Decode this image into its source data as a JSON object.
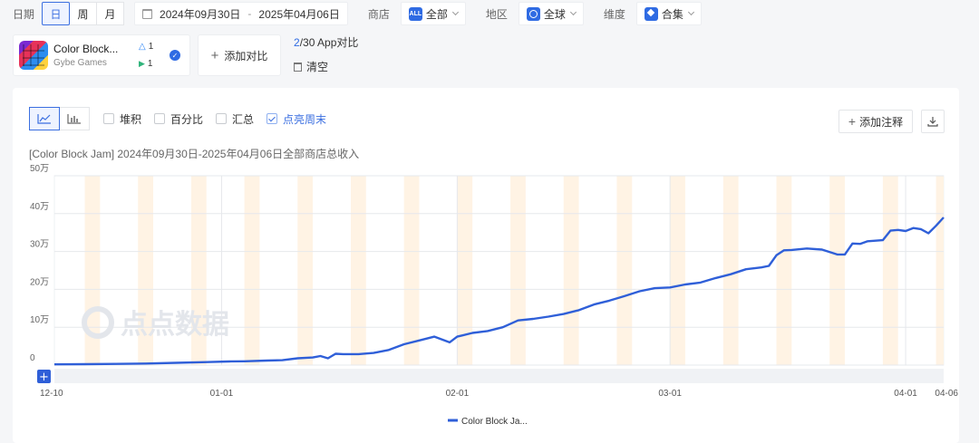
{
  "filters": {
    "date_label": "日期",
    "granularity": [
      {
        "label": "日",
        "active": true
      },
      {
        "label": "周",
        "active": false
      },
      {
        "label": "月",
        "active": false
      }
    ],
    "date_start": "2024年09月30日",
    "date_sep": "-",
    "date_end": "2025年04月06日",
    "store_label": "商店",
    "store_icon_text": "ALL",
    "store_value": "全部",
    "region_label": "地区",
    "region_value": "全球",
    "dimension_label": "维度",
    "dimension_value": "合集"
  },
  "app": {
    "name": "Color Block...",
    "developer": "Gybe Games",
    "ios_count": "1",
    "gp_count": "1"
  },
  "compare": {
    "add_label": "添加对比",
    "count_current": "2",
    "count_rest": "/30 App对比",
    "clear_label": "清空"
  },
  "options": {
    "stack": "堆积",
    "percent": "百分比",
    "summary": "汇总",
    "weekend": "点亮周末"
  },
  "actions": {
    "add_note": "添加注释"
  },
  "watermark": "点点数据",
  "colors": {
    "line": "#2f5fd8",
    "weekend_band": "#fff3e4",
    "accent": "#3b6fe0"
  },
  "chart_data": {
    "type": "line",
    "title": "[Color Block Jam] 2024年09月30日-2025年04月06日全部商店总收入",
    "y_unit": "万",
    "ylim": [
      0,
      500000
    ],
    "y_ticks": [
      {
        "value": 0,
        "label": "0"
      },
      {
        "value": 100000,
        "label": "10万"
      },
      {
        "value": 200000,
        "label": "20万"
      },
      {
        "value": 300000,
        "label": "30万"
      },
      {
        "value": 400000,
        "label": "40万"
      },
      {
        "value": 500000,
        "label": "50万"
      }
    ],
    "x_range": [
      "2024-12-10",
      "2025-04-06"
    ],
    "x_ticks": [
      {
        "date": "2024-12-10",
        "label": "12-10"
      },
      {
        "date": "2025-01-01",
        "label": "01-01"
      },
      {
        "date": "2025-02-01",
        "label": "02-01"
      },
      {
        "date": "2025-03-01",
        "label": "03-01"
      },
      {
        "date": "2025-04-01",
        "label": "04-01"
      },
      {
        "date": "2025-04-06",
        "label": "04-06"
      }
    ],
    "grid": true,
    "weekend_highlight": true,
    "legend_position": "bottom-center",
    "series": [
      {
        "name": "Color Block Ja...",
        "color": "#2f5fd8",
        "points": [
          [
            "2024-12-10",
            2000
          ],
          [
            "2024-12-14",
            2500
          ],
          [
            "2024-12-18",
            3000
          ],
          [
            "2024-12-22",
            4000
          ],
          [
            "2024-12-26",
            6000
          ],
          [
            "2024-12-30",
            8000
          ],
          [
            "2025-01-02",
            9500
          ],
          [
            "2025-01-04",
            10000
          ],
          [
            "2025-01-07",
            12000
          ],
          [
            "2025-01-09",
            13000
          ],
          [
            "2025-01-11",
            18000
          ],
          [
            "2025-01-13",
            20000
          ],
          [
            "2025-01-14",
            24000
          ],
          [
            "2025-01-15",
            18000
          ],
          [
            "2025-01-16",
            30000
          ],
          [
            "2025-01-17",
            29000
          ],
          [
            "2025-01-19",
            29000
          ],
          [
            "2025-01-21",
            32000
          ],
          [
            "2025-01-23",
            40000
          ],
          [
            "2025-01-25",
            55000
          ],
          [
            "2025-01-27",
            65000
          ],
          [
            "2025-01-29",
            75000
          ],
          [
            "2025-01-31",
            60000
          ],
          [
            "2025-02-01",
            75000
          ],
          [
            "2025-02-03",
            85000
          ],
          [
            "2025-02-05",
            90000
          ],
          [
            "2025-02-07",
            100000
          ],
          [
            "2025-02-09",
            118000
          ],
          [
            "2025-02-11",
            122000
          ],
          [
            "2025-02-13",
            128000
          ],
          [
            "2025-02-15",
            135000
          ],
          [
            "2025-02-17",
            145000
          ],
          [
            "2025-02-19",
            160000
          ],
          [
            "2025-02-21",
            170000
          ],
          [
            "2025-02-23",
            182000
          ],
          [
            "2025-02-25",
            195000
          ],
          [
            "2025-02-27",
            203000
          ],
          [
            "2025-03-01",
            205000
          ],
          [
            "2025-03-03",
            213000
          ],
          [
            "2025-03-05",
            218000
          ],
          [
            "2025-03-07",
            230000
          ],
          [
            "2025-03-09",
            240000
          ],
          [
            "2025-03-11",
            253000
          ],
          [
            "2025-03-13",
            258000
          ],
          [
            "2025-03-14",
            262000
          ],
          [
            "2025-03-15",
            290000
          ],
          [
            "2025-03-16",
            303000
          ],
          [
            "2025-03-17",
            304000
          ],
          [
            "2025-03-19",
            308000
          ],
          [
            "2025-03-21",
            305000
          ],
          [
            "2025-03-23",
            292000
          ],
          [
            "2025-03-24",
            292000
          ],
          [
            "2025-03-25",
            321000
          ],
          [
            "2025-03-26",
            320000
          ],
          [
            "2025-03-27",
            327000
          ],
          [
            "2025-03-29",
            330000
          ],
          [
            "2025-03-30",
            355000
          ],
          [
            "2025-03-31",
            357000
          ],
          [
            "2025-04-01",
            354000
          ],
          [
            "2025-04-02",
            362000
          ],
          [
            "2025-04-03",
            359000
          ],
          [
            "2025-04-04",
            348000
          ],
          [
            "2025-04-05",
            368000
          ],
          [
            "2025-04-06",
            390000
          ]
        ]
      }
    ]
  }
}
